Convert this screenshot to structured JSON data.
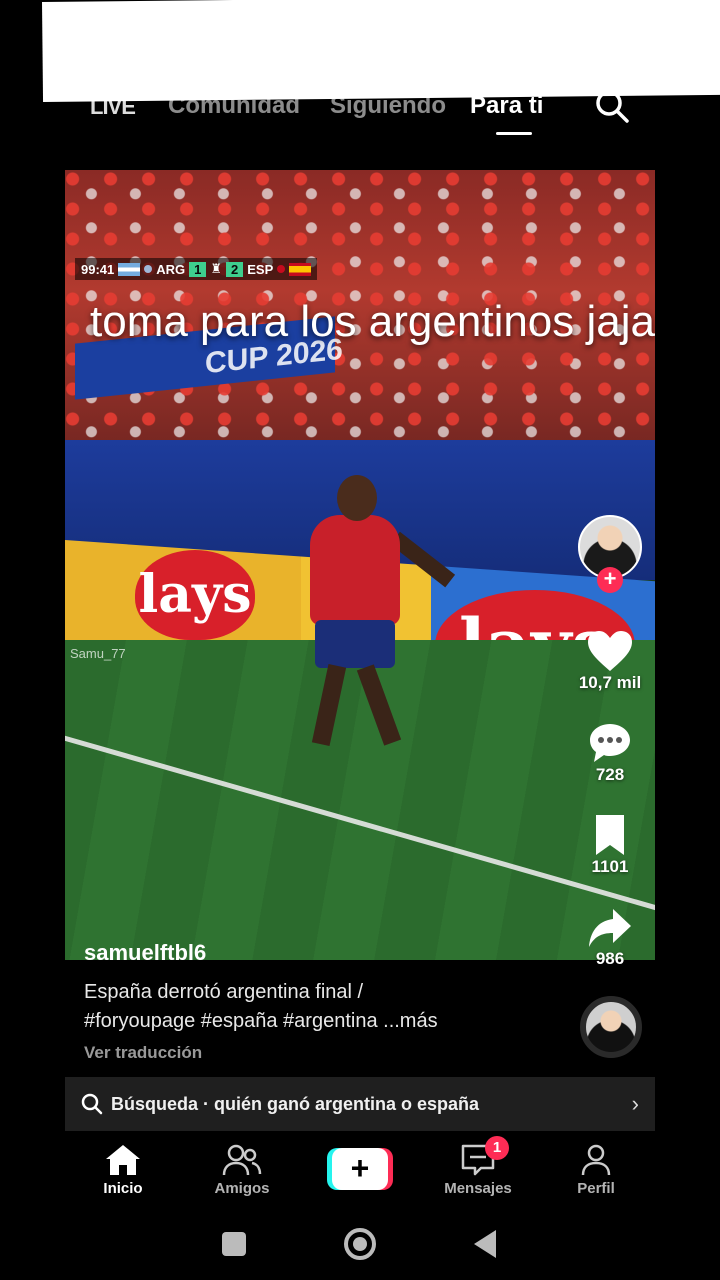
{
  "top_nav": {
    "live_label": "LIVE",
    "tabs": [
      {
        "label": "Comunidad"
      },
      {
        "label": "Siguiendo"
      },
      {
        "label": "Para ti"
      }
    ],
    "active_tab": "Para ti",
    "search_icon": "search-icon"
  },
  "video": {
    "scorebug": {
      "clock": "99:41",
      "home": "ARG",
      "home_score": "1",
      "away": "ESP",
      "away_score": "2"
    },
    "overlay_text": "toma para los argentinos jaja",
    "banner_text": "CUP 2026",
    "ad_brand": "lays",
    "watermark": "Samu_77"
  },
  "actions": {
    "likes": "10,7 mil",
    "comments": "728",
    "saves": "1101",
    "shares": "986"
  },
  "post": {
    "username": "samuelftbl6",
    "caption_line1": "España derrotó argentina final /",
    "caption_line2": "#foryoupage #españa #argentina ...más",
    "translate_label": "Ver traducción"
  },
  "search_bar": {
    "text": "Búsqueda · quién ganó argentina o españa",
    "chevron": "›"
  },
  "bottom_nav": {
    "items": [
      {
        "label": "Inicio",
        "icon": "home-icon"
      },
      {
        "label": "Amigos",
        "icon": "friends-icon"
      },
      {
        "label": "+",
        "icon": "create-icon"
      },
      {
        "label": "Mensajes",
        "icon": "inbox-icon"
      },
      {
        "label": "Perfil",
        "icon": "profile-icon"
      }
    ],
    "messages_badge": "1"
  },
  "colors": {
    "accent_red": "#fe2c55",
    "accent_cyan": "#25f4ee",
    "background": "#000000"
  }
}
